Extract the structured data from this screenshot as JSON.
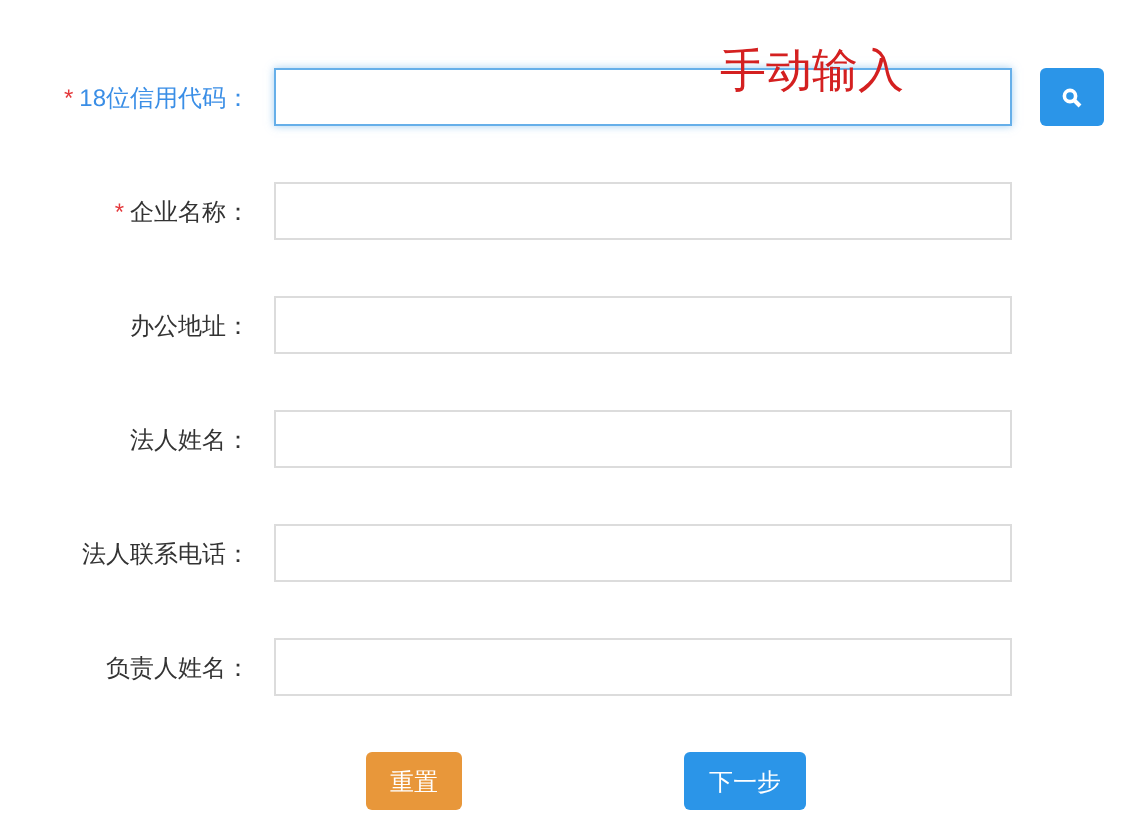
{
  "fields": [
    {
      "marker": "*",
      "label": "18位信用代码：",
      "focused": true,
      "search_button": true
    },
    {
      "marker": "*",
      "label": "企业名称：",
      "focused": false,
      "search_button": false
    },
    {
      "label": "办公地址：",
      "focused": false,
      "search_button": false
    },
    {
      "label": "法人姓名：",
      "focused": false,
      "search_button": false
    },
    {
      "label": "法人联系电话：",
      "focused": false,
      "search_button": false
    },
    {
      "label": "负责人姓名：",
      "focused": false,
      "search_button": false
    }
  ],
  "annotation": "手动输入",
  "buttons": [
    {
      "label": "重置",
      "kind": "reset"
    },
    {
      "label": "下一步",
      "kind": "next"
    }
  ]
}
